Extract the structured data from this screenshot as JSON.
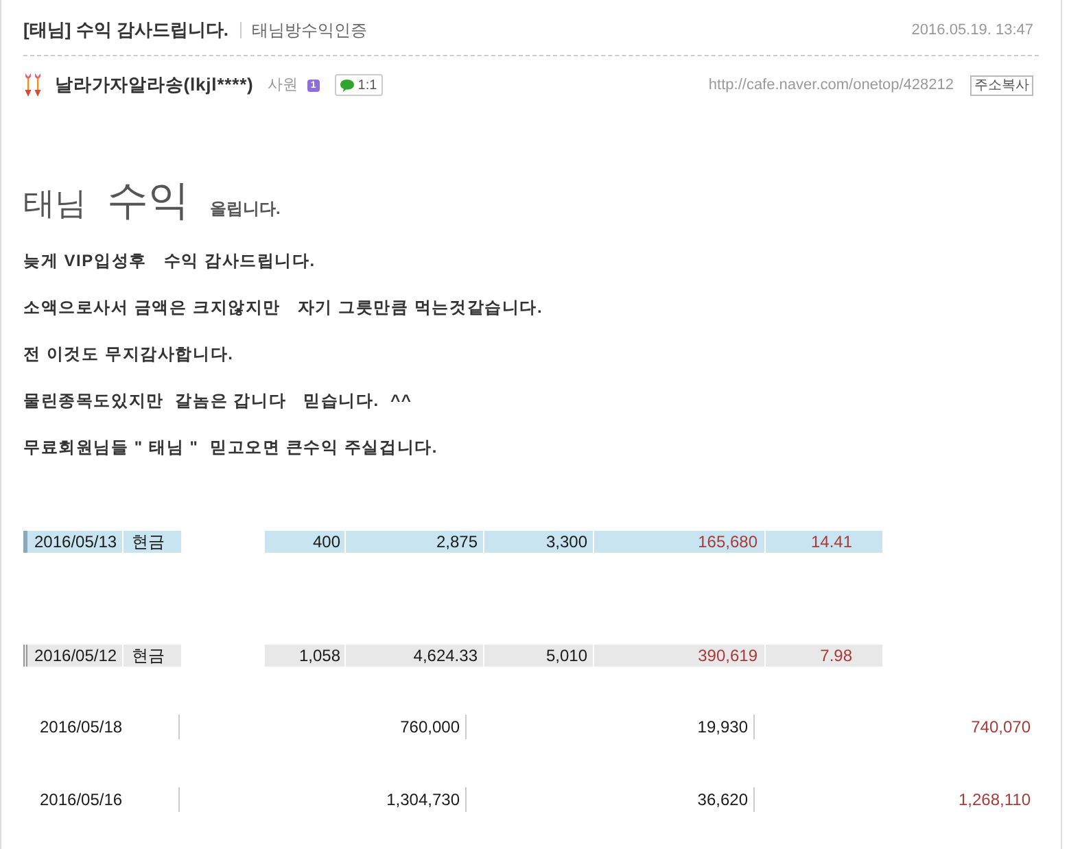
{
  "post": {
    "title": "[태님] 수익 감사드립니다.",
    "category": "태님방수익인증",
    "date": "2016.05.19. 13:47"
  },
  "author": {
    "name": "날라가자알라송(lkjl****)",
    "rank": "사원",
    "level": "1",
    "chat_button": "1:1",
    "url": "http://cafe.naver.com/onetop/428212",
    "copy_button": "주소복사"
  },
  "headline": [
    {
      "text": "태님",
      "kind": "large"
    },
    {
      "text": "수익",
      "kind": "xlarge"
    },
    {
      "text": "올립니다.",
      "kind": "small"
    }
  ],
  "paragraphs": [
    "늦게 VIP입성후   수익 감사드립니다.",
    "소액으로사서 금액은 크지않지만   자기 그릇만큼 먹는것같습니다.",
    "전 이것도 무지감사합니다.",
    "물린종목도있지만  갈놈은 갑니다   믿습니다.  ^^",
    "무료회원님들 \" 태님 \"  믿고오면 큰수익 주실겁니다."
  ],
  "trade_rows": [
    {
      "selected": true,
      "date": "2016/05/13",
      "type": "현금",
      "values": [
        {
          "text": "400",
          "color": "#1a1a1a"
        },
        {
          "text": "2,875",
          "color": "#1a1a1a"
        },
        {
          "text": "3,300",
          "color": "#1a1a1a"
        },
        {
          "text": "165,680",
          "color": "#a83a3a"
        },
        {
          "text": "14.41",
          "color": "#a83a3a"
        }
      ]
    },
    {
      "selected": false,
      "date": "2016/05/12",
      "type": "현금",
      "values": [
        {
          "text": "1,058",
          "color": "#1a1a1a"
        },
        {
          "text": "4,624.33",
          "color": "#1a1a1a"
        },
        {
          "text": "5,010",
          "color": "#1a1a1a"
        },
        {
          "text": "390,619",
          "color": "#a83a3a"
        },
        {
          "text": "7.98",
          "color": "#a83a3a"
        }
      ]
    }
  ],
  "settlement_rows": [
    {
      "date": "2016/05/18",
      "values": [
        {
          "text": "760,000",
          "color": "#1a1a1a"
        },
        {
          "text": "19,930",
          "color": "#1a1a1a"
        },
        {
          "text": "740,070",
          "color": "#a83a3a"
        }
      ]
    },
    {
      "date": "2016/05/16",
      "values": [
        {
          "text": "1,304,730",
          "color": "#1a1a1a"
        },
        {
          "text": "36,620",
          "color": "#1a1a1a"
        },
        {
          "text": "1,268,110",
          "color": "#a83a3a"
        }
      ]
    }
  ]
}
